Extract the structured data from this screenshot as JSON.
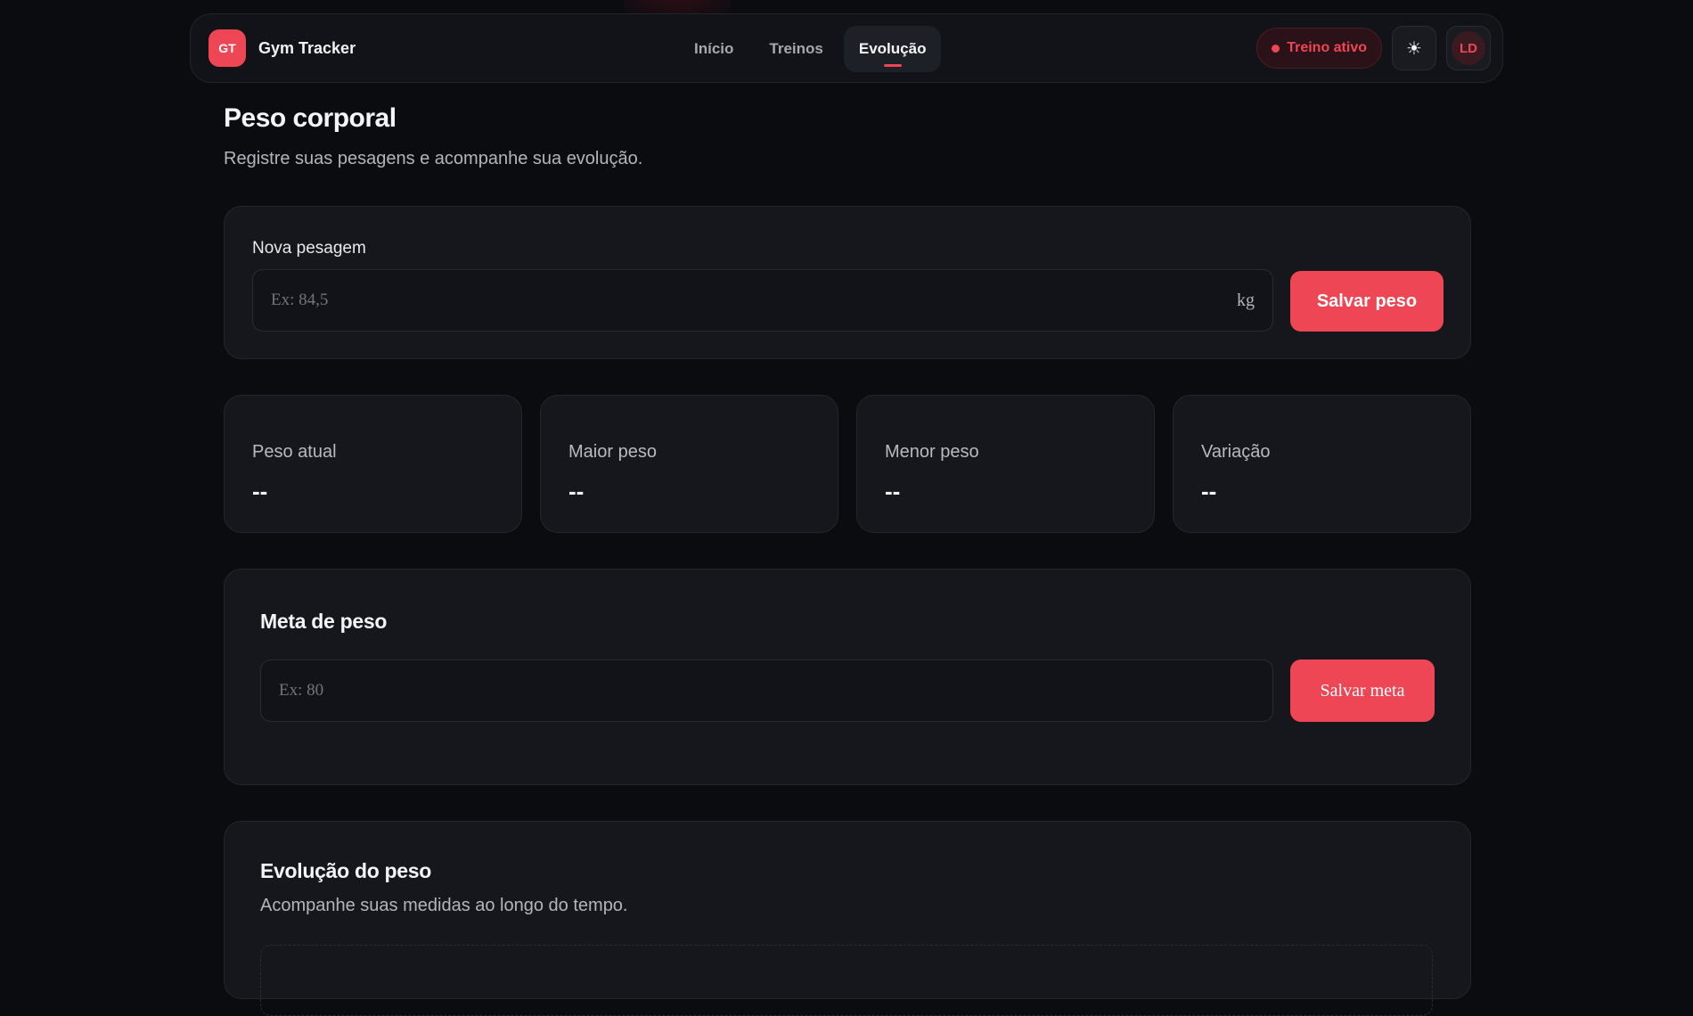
{
  "nav": {
    "brand_initials": "GT",
    "brand_name": "Gym Tracker",
    "items": [
      {
        "label": "Início",
        "active": false
      },
      {
        "label": "Treinos",
        "active": false
      },
      {
        "label": "Evolução",
        "active": true
      }
    ],
    "status_pill": "Treino ativo",
    "theme_icon": "sun-icon",
    "avatar_initials": "LD"
  },
  "page": {
    "title": "Peso corporal",
    "subtitle": "Registre suas pesagens e acompanhe sua evolução."
  },
  "new_weight": {
    "label": "Nova pesagem",
    "placeholder": "Ex: 84,5",
    "value": "",
    "unit": "kg",
    "button": "Salvar peso"
  },
  "stats": [
    {
      "label": "Peso atual",
      "value": "--"
    },
    {
      "label": "Maior peso",
      "value": "--"
    },
    {
      "label": "Menor peso",
      "value": "--"
    },
    {
      "label": "Variação",
      "value": "--"
    }
  ],
  "goal": {
    "title": "Meta de peso",
    "placeholder": "Ex: 80",
    "value": "",
    "button": "Salvar meta"
  },
  "evolution": {
    "title": "Evolução do peso",
    "subtitle": "Acompanhe suas medidas ao longo do tempo."
  },
  "colors": {
    "accent": "#ef4655",
    "background": "#0b0c10",
    "card": "#16171c"
  }
}
